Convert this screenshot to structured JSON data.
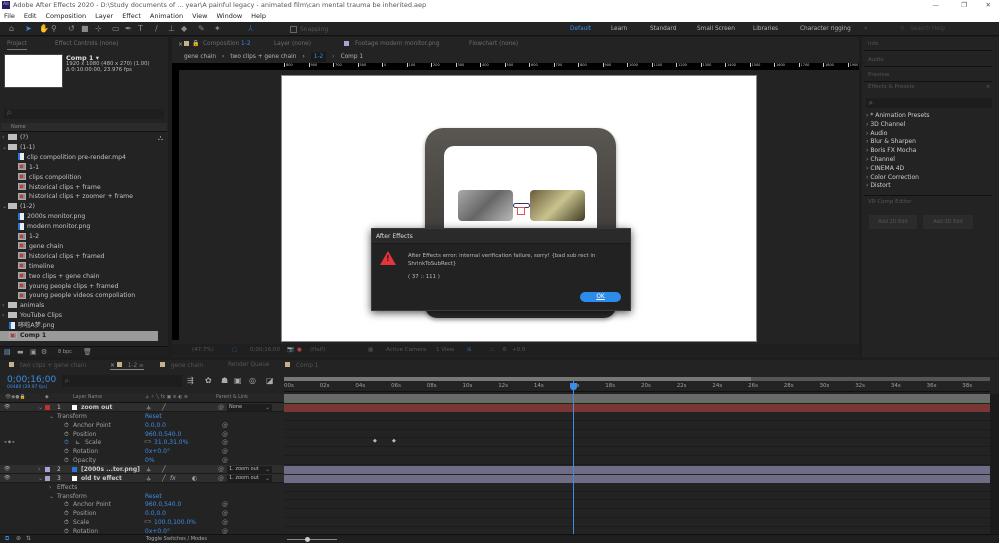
{
  "window": {
    "title": "Adobe After Effects 2020 - D:\\Study documents of ... year\\A painful legacy - animated film\\can mental trauma be inherited.aep",
    "app_icon": "Ae",
    "minimize": "—",
    "maximize": "❐",
    "close": "✕"
  },
  "menu": [
    "File",
    "Edit",
    "Composition",
    "Layer",
    "Effect",
    "Animation",
    "View",
    "Window",
    "Help"
  ],
  "toolbar": {
    "snapping": "Snapping"
  },
  "workspaces": {
    "items": [
      "Default",
      "Learn",
      "Standard",
      "Small Screen",
      "Libraries",
      "Character rigging"
    ],
    "active": "Default",
    "more": "»",
    "search_placeholder": "Search Help"
  },
  "project": {
    "tab_project": "Project",
    "tab_effect_controls": "Effect Controls (none)",
    "comp_name": "Comp 1 ▾",
    "comp_res": "1920 x 1080  (480 x 270) (1.00)",
    "comp_duration": "Δ 0:10:00:00, 23.976 fps",
    "search_placeholder": "ρ.",
    "col_name": "Name",
    "bpc": "8 bpc",
    "items": [
      {
        "label": "(?)",
        "type": "folder",
        "indent": 0,
        "arrow": ">"
      },
      {
        "label": "(1-1)",
        "type": "folder",
        "indent": 0,
        "arrow": "v"
      },
      {
        "label": "clip compolition pre-render.mp4",
        "type": "footage",
        "indent": 1
      },
      {
        "label": "1-1",
        "type": "comp",
        "indent": 1
      },
      {
        "label": "clips compolition",
        "type": "comp",
        "indent": 1
      },
      {
        "label": "historical clips + frame",
        "type": "comp",
        "indent": 1
      },
      {
        "label": "historical clips + zoomer + frame",
        "type": "comp",
        "indent": 1
      },
      {
        "label": "(1-2)",
        "type": "folder",
        "indent": 0,
        "arrow": "v"
      },
      {
        "label": "2000s monitor.png",
        "type": "footage",
        "indent": 1
      },
      {
        "label": "modern monitor.png",
        "type": "footage",
        "indent": 1
      },
      {
        "label": "1-2",
        "type": "comp",
        "indent": 1
      },
      {
        "label": "gene chain",
        "type": "comp",
        "indent": 1
      },
      {
        "label": "historical clips + framed",
        "type": "comp",
        "indent": 1
      },
      {
        "label": "timeline",
        "type": "comp",
        "indent": 1
      },
      {
        "label": "two clips + gene chain",
        "type": "comp",
        "indent": 1
      },
      {
        "label": "young people clips + framed",
        "type": "comp",
        "indent": 1
      },
      {
        "label": "young people videos compoliation",
        "type": "comp",
        "indent": 1
      },
      {
        "label": "animals",
        "type": "folder",
        "indent": 0,
        "arrow": ">"
      },
      {
        "label": "YouTube Clips",
        "type": "folder",
        "indent": 0,
        "arrow": ">"
      },
      {
        "label": "哆啦A梦.png",
        "type": "footage",
        "indent": 0
      },
      {
        "label": "Comp 1",
        "type": "comp",
        "indent": 0,
        "selected": true
      }
    ]
  },
  "viewer": {
    "tab_comp_prefix": "Composition",
    "tab_comp_name": "1-2",
    "tab_layer": "Layer (none)",
    "tab_footage": "Footage modern monitor.png",
    "tab_flowchart": "Flowchart (none)",
    "breadcrumbs": [
      "gene chain",
      "two clips + gene chain",
      "1-2",
      "Comp 1"
    ],
    "ruler": [
      "800",
      "900",
      "700",
      "500",
      "0",
      "100",
      "200",
      "300",
      "400",
      "500",
      "600",
      "700",
      "800",
      "900",
      "1000",
      "1100",
      "1200",
      "1300",
      "1400",
      "1500",
      "1600",
      "1700",
      "1800",
      "1900",
      "2000",
      "2100",
      "2200"
    ],
    "zoom": "(47.7%)",
    "timecode": "0;00;16;00",
    "resolution": "(Half)",
    "camera": "Active Camera",
    "views": "1 View",
    "exposure": "+0.0"
  },
  "dialog": {
    "title": "After Effects",
    "message": "After Effects error: internal verification failure, sorry! {bad sub rect in ShrinkToSubRect}",
    "code": "( 37 :: 111 )",
    "ok": "OK",
    "warning_color": "#e8333a",
    "ok_color": "#2d8ceb"
  },
  "right_panel": {
    "info": "Info",
    "audio": "Audio",
    "preview": "Preview",
    "effects_title": "Effects & Presets",
    "search_placeholder": "ρ.",
    "effects": [
      "* Animation Presets",
      "3D Channel",
      "Audio",
      "Blur & Sharpen",
      "Boris FX Mocha",
      "Channel",
      "CINEMA 4D",
      "Color Correction",
      "Distort"
    ],
    "vr_title": "VR Comp Editor",
    "add_2d": "Add 2D Edit",
    "add_3d": "Add 3D Edit"
  },
  "timeline": {
    "tabs": [
      "two clips + gene chain",
      "1-2",
      "gene chain",
      "Render Queue",
      "Comp 1"
    ],
    "active_tab": "1-2",
    "timecode": "0;00;16;00",
    "frames": "00480 (29.97 fps)",
    "search_placeholder": "ρ.",
    "col_layer_name": "Layer Name",
    "col_parent": "Parent & Link",
    "toggle": "Toggle Switches / Modes",
    "ruler": [
      "00s",
      "02s",
      "04s",
      "06s",
      "08s",
      "10s",
      "12s",
      "14s",
      "16s",
      "18s",
      "20s",
      "22s",
      "24s",
      "26s",
      "28s",
      "30s",
      "32s",
      "34s",
      "36s",
      "38s"
    ],
    "current_time_s": 16,
    "work_area_end_s": 26,
    "rows": [
      {
        "kind": "layer",
        "num": "1",
        "name": "zoom out",
        "label_color": "#c0302e",
        "parent": "None",
        "bar": "#7a3535",
        "expanded": true
      },
      {
        "kind": "group",
        "name": "Transform",
        "value": "Reset"
      },
      {
        "kind": "prop",
        "name": "Anchor Point",
        "value": "0.0,0.0"
      },
      {
        "kind": "prop",
        "name": "Position",
        "value": "960.0,540.0"
      },
      {
        "kind": "prop",
        "name": "Scale",
        "value": "31.0,31.0%",
        "keyed": true
      },
      {
        "kind": "prop",
        "name": "Rotation",
        "value": "0x+0.0°"
      },
      {
        "kind": "prop",
        "name": "Opacity",
        "value": "0%"
      },
      {
        "kind": "layer",
        "num": "2",
        "name": "[2000s ...tor.png]",
        "label_color": "#a9a3cf",
        "parent": "1. zoom out",
        "bar": "#6f6c86"
      },
      {
        "kind": "layer",
        "num": "3",
        "name": "old tv effect",
        "label_color": "#a9a3cf",
        "parent": "1. zoom out",
        "bar": "#6f6c86",
        "expanded": true
      },
      {
        "kind": "group",
        "name": "Effects",
        "value": ""
      },
      {
        "kind": "group",
        "name": "Transform",
        "value": "Reset"
      },
      {
        "kind": "prop",
        "name": "Anchor Point",
        "value": "960.0,540.0"
      },
      {
        "kind": "prop",
        "name": "Position",
        "value": "0.0,0.0"
      },
      {
        "kind": "prop",
        "name": "Scale",
        "value": "100.0,100.0%"
      },
      {
        "kind": "prop",
        "name": "Rotation",
        "value": "0x+0.0°"
      }
    ]
  }
}
